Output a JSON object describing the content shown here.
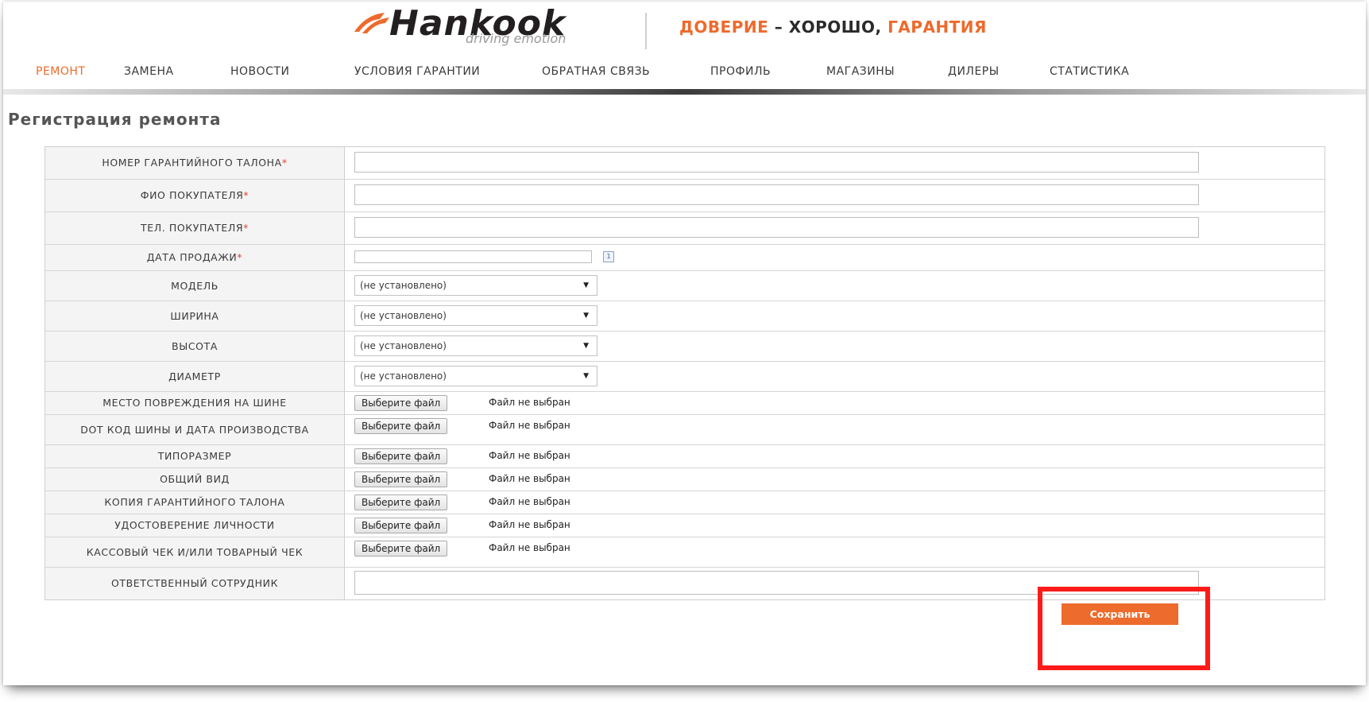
{
  "header": {
    "logo_word": "Hankook",
    "logo_tagline": "driving emotion",
    "slogan_part1": "ДОВЕРИЕ",
    "slogan_part2": " – ХОРОШО, ",
    "slogan_part3": "ГАРАНТИЯ"
  },
  "nav": {
    "items": [
      {
        "label": "РЕМОНТ",
        "active": true
      },
      {
        "label": "ЗАМЕНА"
      },
      {
        "label": "НОВОСТИ"
      },
      {
        "label": "УСЛОВИЯ ГАРАНТИИ"
      },
      {
        "label": "ОБРАТНАЯ СВЯЗЬ"
      },
      {
        "label": "ПРОФИЛЬ"
      },
      {
        "label": "МАГАЗИНЫ"
      },
      {
        "label": "ДИЛЕРЫ"
      },
      {
        "label": "СТАТИСТИКА"
      }
    ]
  },
  "page": {
    "title": "Регистрация ремонта"
  },
  "form": {
    "required_mark": "*",
    "warranty_number_label": "НОМЕР ГАРАНТИЙНОГО ТАЛОНА",
    "buyer_name_label": "ФИО ПОКУПАТЕЛЯ",
    "buyer_phone_label": "ТЕЛ. ПОКУПАТЕЛЯ",
    "sale_date_label": "ДАТА ПРОДАЖИ",
    "calendar_glyph": "1",
    "select_placeholder": "(не установлено)",
    "model_label": "МОДЕЛЬ",
    "width_label": "ШИРИНА",
    "height_label": "ВЫСОТА",
    "diameter_label": "ДИАМЕТР",
    "choose_file_label": "Выберите файл",
    "no_file_label": "Файл не выбран",
    "file_fields": {
      "damage_place": "МЕСТО ПОВРЕЖДЕНИЯ НА ШИНЕ",
      "dot_code": "DOT КОД ШИНЫ И ДАТА ПРОИЗВОДСТВА",
      "tire_size": "ТИПОРАЗМЕР",
      "general_view": "ОБЩИЙ ВИД",
      "warranty_copy": "КОПИЯ ГАРАНТИЙНОГО ТАЛОНА",
      "id_document": "УДОСТОВЕРЕНИЕ ЛИЧНОСТИ",
      "receipt": "КАССОВЫЙ ЧЕК И/ИЛИ ТОВАРНЫЙ ЧЕК"
    },
    "employee_label": "ОТВЕТСТВЕННЫЙ СОТРУДНИК",
    "save_label": "Сохранить"
  },
  "colors": {
    "accent": "#ee6a2c",
    "highlight": "#ff1a1a",
    "label_bg": "#f4f4f4"
  },
  "icons": [
    "hankook-logo-icon",
    "calendar-icon",
    "chevron-down-icon"
  ]
}
